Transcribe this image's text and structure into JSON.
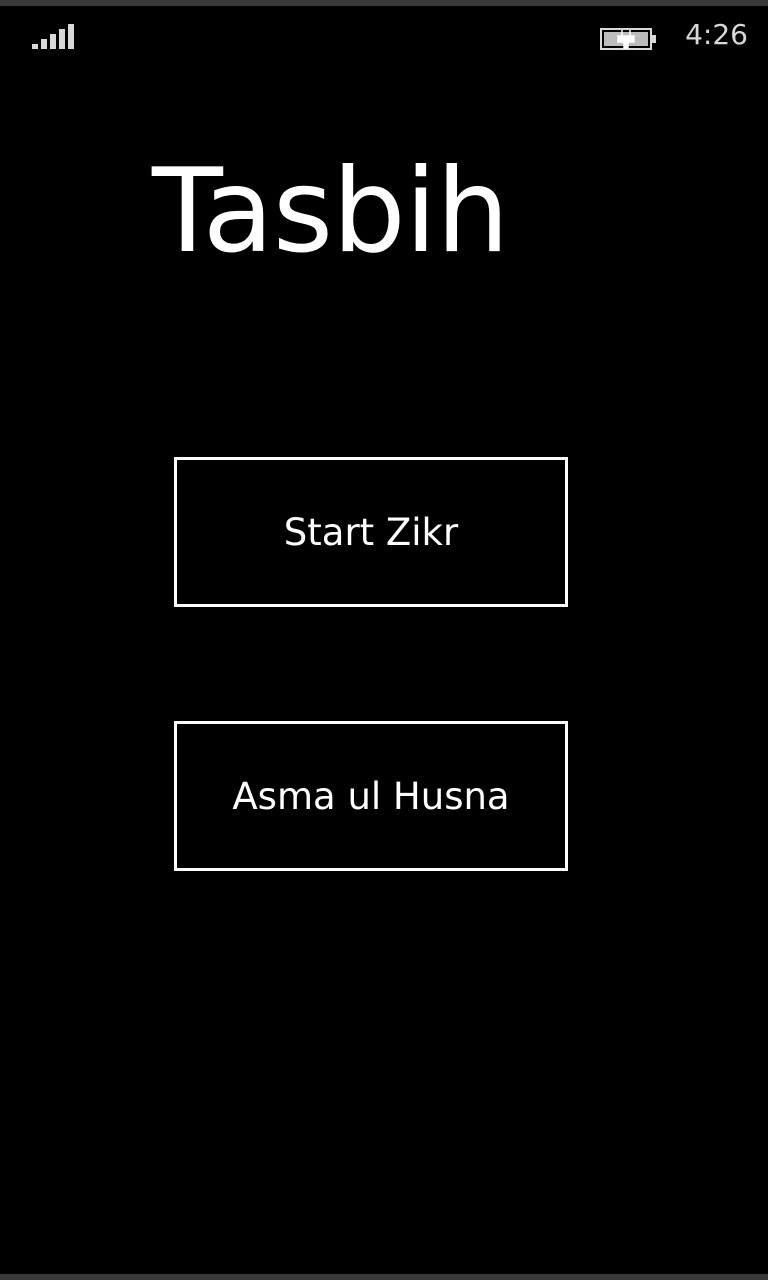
{
  "status_bar": {
    "signal_icon": "signal-strength-icon",
    "battery_icon": "battery-charging-icon",
    "time": "4:26"
  },
  "app": {
    "title": "Tasbih"
  },
  "menu": {
    "start_zikr_label": "Start Zikr",
    "asma_ul_husna_label": "Asma ul Husna"
  },
  "colors": {
    "background": "#000000",
    "foreground": "#ffffff",
    "status_text": "#d8d8d8"
  }
}
